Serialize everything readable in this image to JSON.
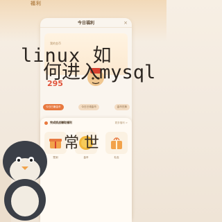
{
  "header": {
    "badge_text": "福利",
    "title": "今日福利",
    "close": "×"
  },
  "wallet": {
    "coin_label": "我的金币",
    "coin_value": "295"
  },
  "pills": [
    "今日已赚金币",
    "今日已领金币",
    "金币兑换"
  ],
  "panel": {
    "title": "完成挑战赚取福利",
    "more": "更多福利 >",
    "rewards": [
      {
        "label": "签到",
        "icon": "gift-icon"
      },
      {
        "label": "金币",
        "icon": "coin-icon"
      },
      {
        "label": "礼包",
        "icon": "gift-box-icon"
      }
    ]
  },
  "overlay": {
    "line1": "linux 如",
    "line2": "何进入mysql",
    "line3": "常 世"
  },
  "colors": {
    "accent": "#e8793f",
    "coin": "#e0533b",
    "bg": "#f3eadf"
  }
}
